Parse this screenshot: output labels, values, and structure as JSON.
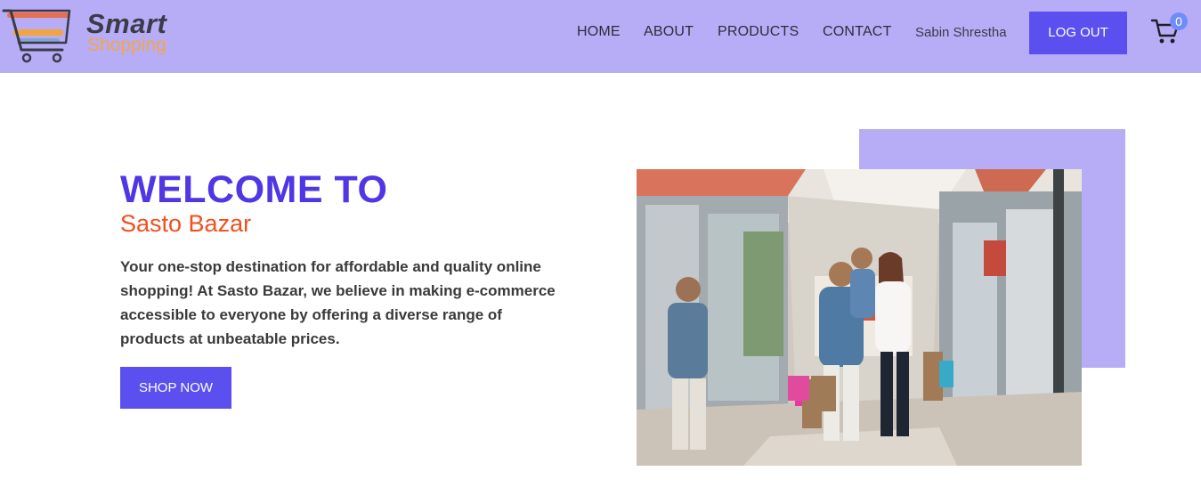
{
  "brand": {
    "name_line1": "Smart",
    "name_line2": "Shopping"
  },
  "nav": {
    "links": [
      "HOME",
      "ABOUT",
      "PRODUCTS",
      "CONTACT"
    ],
    "username": "Sabin Shrestha",
    "logout_label": "LOG OUT",
    "cart_count": "0"
  },
  "hero": {
    "title": "WELCOME TO",
    "subtitle": "Sasto Bazar",
    "description": "Your one-stop destination for affordable and quality online shopping! At Sasto Bazar, we believe in making e-commerce accessible to everyone by offering a diverse range of products at unbeatable prices.",
    "cta_label": "SHOP NOW"
  },
  "colors": {
    "navbar_bg": "#b6adf6",
    "primary": "#5b4ff0",
    "title": "#4f37e6",
    "subtitle": "#f0501e"
  },
  "icons": {
    "logo": "shopping-cart-logo",
    "cart": "cart-icon"
  }
}
